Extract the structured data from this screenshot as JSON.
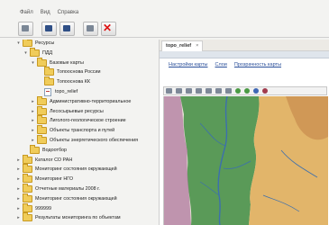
{
  "menu": {
    "items": [
      "Файл",
      "Вид",
      "Справка"
    ]
  },
  "tree": {
    "rows": [
      {
        "label": "Ресурсы",
        "level": 0,
        "toggle": "▾",
        "icon": "folder"
      },
      {
        "label": "ПДД",
        "level": 1,
        "toggle": "▾",
        "icon": "folder"
      },
      {
        "label": "Базовые карты",
        "level": 2,
        "toggle": "▾",
        "icon": "folder"
      },
      {
        "label": "Топооснова России",
        "level": 3,
        "toggle": "",
        "icon": "folder"
      },
      {
        "label": "Топооснова КК",
        "level": 3,
        "toggle": "",
        "icon": "folder"
      },
      {
        "label": "topo_relief",
        "level": 3,
        "toggle": "",
        "icon": "doc"
      },
      {
        "label": "Административно-территориальное",
        "level": 2,
        "toggle": "▸",
        "icon": "folder"
      },
      {
        "label": "Лесосырьевые ресурсы",
        "level": 2,
        "toggle": "▸",
        "icon": "folder"
      },
      {
        "label": "Лиголого-геологическое строение",
        "level": 2,
        "toggle": "▸",
        "icon": "folder"
      },
      {
        "label": "Объекты транспорта и путей",
        "level": 2,
        "toggle": "▸",
        "icon": "folder"
      },
      {
        "label": "Объекты энергетического обеспечения",
        "level": 2,
        "toggle": "▸",
        "icon": "folder"
      },
      {
        "label": "Водоотбор",
        "level": 1,
        "toggle": "",
        "icon": "folder"
      },
      {
        "label": "Каталог СО РАН",
        "level": 0,
        "toggle": "▸",
        "icon": "folder"
      },
      {
        "label": "Мониторинг состояния окружающей",
        "level": 0,
        "toggle": "▸",
        "icon": "folder"
      },
      {
        "label": "Мониторинг НГО",
        "level": 0,
        "toggle": "▸",
        "icon": "folder"
      },
      {
        "label": "Отчетные материалы 2008 г.",
        "level": 0,
        "toggle": "▸",
        "icon": "folder"
      },
      {
        "label": "Мониторинг состояния окружающей",
        "level": 0,
        "toggle": "▸",
        "icon": "folder"
      },
      {
        "label": "999999",
        "level": 0,
        "toggle": "▸",
        "icon": "folder"
      },
      {
        "label": "Результаты мониторинга по объектам",
        "level": 0,
        "toggle": "▸",
        "icon": "folder"
      }
    ]
  },
  "panel": {
    "tab_label": "topo_relief",
    "tab_close": "×",
    "links": [
      "Настройки карты",
      "Слои",
      "Прозрачность карты"
    ]
  },
  "colors": {
    "lowland": "#5a9a58",
    "highland": "#e2b56a",
    "water": "#3c6fae",
    "relief_edge": "#b07aa0"
  }
}
